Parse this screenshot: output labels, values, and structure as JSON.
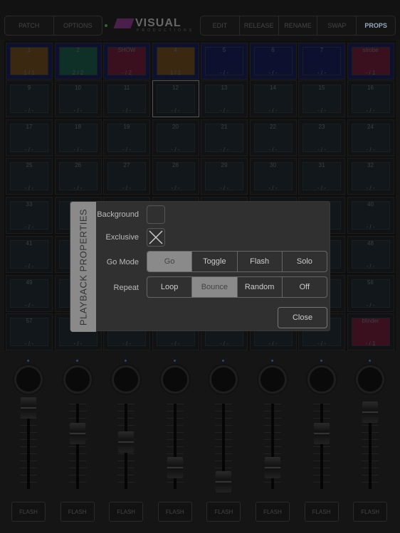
{
  "toolbar": {
    "left": [
      "PATCH",
      "OPTIONS"
    ],
    "right": [
      "EDIT",
      "RELEASE",
      "RENAME",
      "SWAP",
      "PROPS"
    ],
    "active": "PROPS"
  },
  "logo": {
    "text": "VISUAL",
    "sub": "PRODUCTIONS"
  },
  "colors": {
    "orange": "#3a2810",
    "green": "#0f3026",
    "red": "#3a0f1e",
    "blue": "#0e1030",
    "dim": "#12171b"
  },
  "playbacks": [
    {
      "n": "1",
      "b": "1 / 1",
      "c": "orange"
    },
    {
      "n": "2",
      "b": "2 / 2",
      "c": "green"
    },
    {
      "n": "SHOW",
      "b": "- / 2",
      "c": "red"
    },
    {
      "n": "4",
      "b": "1 / 1",
      "c": "orange"
    },
    {
      "n": "5",
      "b": "- / -",
      "c": "blue"
    },
    {
      "n": "6",
      "b": "- / -",
      "c": "blue"
    },
    {
      "n": "7",
      "b": "- / -",
      "c": "blue"
    },
    {
      "n": "strobe",
      "b": "- / 1",
      "c": "red"
    },
    {
      "n": "9",
      "b": "- / -"
    },
    {
      "n": "10",
      "b": "- / -"
    },
    {
      "n": "11",
      "b": "- / -"
    },
    {
      "n": "12",
      "b": "- / -",
      "sel": true
    },
    {
      "n": "13",
      "b": "- / -"
    },
    {
      "n": "14",
      "b": "- / -"
    },
    {
      "n": "15",
      "b": "- / -"
    },
    {
      "n": "16",
      "b": "- / -"
    },
    {
      "n": "17",
      "b": "- / -"
    },
    {
      "n": "18",
      "b": "- / -"
    },
    {
      "n": "19",
      "b": "- / -"
    },
    {
      "n": "20",
      "b": "- / -"
    },
    {
      "n": "21",
      "b": "- / -"
    },
    {
      "n": "22",
      "b": "- / -"
    },
    {
      "n": "23",
      "b": "- / -"
    },
    {
      "n": "24",
      "b": "- / -"
    },
    {
      "n": "25",
      "b": "- / -"
    },
    {
      "n": "26",
      "b": "- / -"
    },
    {
      "n": "27",
      "b": "- / -"
    },
    {
      "n": "28",
      "b": "- / -"
    },
    {
      "n": "29",
      "b": "- / -"
    },
    {
      "n": "30",
      "b": "- / -"
    },
    {
      "n": "31",
      "b": "- / -"
    },
    {
      "n": "32",
      "b": "- / -"
    },
    {
      "n": "33",
      "b": "- / -"
    },
    {
      "n": "",
      "b": ""
    },
    {
      "n": "",
      "b": ""
    },
    {
      "n": "",
      "b": ""
    },
    {
      "n": "",
      "b": ""
    },
    {
      "n": "",
      "b": ""
    },
    {
      "n": "",
      "b": ""
    },
    {
      "n": "40",
      "b": "- / -"
    },
    {
      "n": "41",
      "b": "- / -"
    },
    {
      "n": "",
      "b": ""
    },
    {
      "n": "",
      "b": ""
    },
    {
      "n": "",
      "b": ""
    },
    {
      "n": "",
      "b": ""
    },
    {
      "n": "",
      "b": ""
    },
    {
      "n": "",
      "b": ""
    },
    {
      "n": "48",
      "b": "- / -"
    },
    {
      "n": "49",
      "b": "- / -"
    },
    {
      "n": "",
      "b": ""
    },
    {
      "n": "",
      "b": ""
    },
    {
      "n": "",
      "b": ""
    },
    {
      "n": "",
      "b": ""
    },
    {
      "n": "",
      "b": ""
    },
    {
      "n": "",
      "b": ""
    },
    {
      "n": "56",
      "b": "- / -"
    },
    {
      "n": "57",
      "b": "- / -"
    },
    {
      "n": "",
      "b": "- / -"
    },
    {
      "n": "",
      "b": "- / -"
    },
    {
      "n": "",
      "b": "- / -"
    },
    {
      "n": "",
      "b": "- / -"
    },
    {
      "n": "",
      "b": "- / -"
    },
    {
      "n": "",
      "b": "- / -"
    },
    {
      "n": "blinder",
      "b": "- / 1",
      "c": "red"
    }
  ],
  "dialog": {
    "title": "PLAYBACK PROPERTIES",
    "background_label": "Background",
    "background_checked": false,
    "exclusive_label": "Exclusive",
    "exclusive_checked": true,
    "gomode_label": "Go Mode",
    "gomode_options": [
      "Go",
      "Toggle",
      "Flash",
      "Solo"
    ],
    "gomode_selected": "Go",
    "repeat_label": "Repeat",
    "repeat_options": [
      "Loop",
      "Bounce",
      "Random",
      "Off"
    ],
    "repeat_selected": "Bounce",
    "close_label": "Close"
  },
  "faders": {
    "flash_label": "FLASH",
    "levels": [
      0.95,
      0.65,
      0.55,
      0.25,
      0.08,
      0.25,
      0.65,
      0.9
    ]
  }
}
